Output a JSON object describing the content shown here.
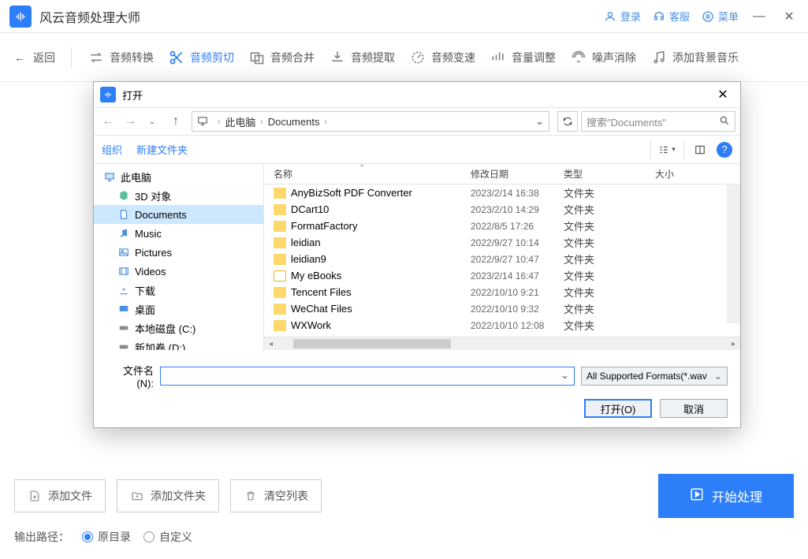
{
  "app": {
    "title": "风云音频处理大师"
  },
  "titlebar": {
    "login": "登录",
    "service": "客服",
    "menu": "菜单"
  },
  "toolbar": {
    "back": "返回",
    "items": [
      "音频转换",
      "音频剪切",
      "音频合并",
      "音频提取",
      "音频变速",
      "音量调整",
      "噪声消除",
      "添加背景音乐"
    ]
  },
  "bottom": {
    "add_file": "添加文件",
    "add_folder": "添加文件夹",
    "clear_list": "清空列表",
    "start": "开始处理",
    "out_label": "输出路径：",
    "orig": "原目录",
    "custom": "自定义"
  },
  "dialog": {
    "title": "打开",
    "crumbs": {
      "pc": "此电脑",
      "doc": "Documents"
    },
    "search_ph": "搜索\"Documents\"",
    "org": "组织",
    "newf": "新建文件夹",
    "cols": {
      "name": "名称",
      "date": "修改日期",
      "type": "类型",
      "size": "大小"
    },
    "tree": [
      {
        "label": "此电脑",
        "icon": "pc",
        "lvl": 0
      },
      {
        "label": "3D 对象",
        "icon": "3d",
        "lvl": 1
      },
      {
        "label": "Documents",
        "icon": "doc",
        "lvl": 1,
        "selected": true
      },
      {
        "label": "Music",
        "icon": "music",
        "lvl": 1
      },
      {
        "label": "Pictures",
        "icon": "pic",
        "lvl": 1
      },
      {
        "label": "Videos",
        "icon": "vid",
        "lvl": 1
      },
      {
        "label": "下载",
        "icon": "dl",
        "lvl": 1
      },
      {
        "label": "桌面",
        "icon": "desk",
        "lvl": 1
      },
      {
        "label": "本地磁盘 (C:)",
        "icon": "disk",
        "lvl": 1
      },
      {
        "label": "新加卷 (D:)",
        "icon": "disk",
        "lvl": 1
      }
    ],
    "files": [
      {
        "name": "AnyBizSoft PDF Converter",
        "date": "2023/2/14 16:38",
        "type": "文件夹",
        "icon": "folder"
      },
      {
        "name": "DCart10",
        "date": "2023/2/10 14:29",
        "type": "文件夹",
        "icon": "folder"
      },
      {
        "name": "FormatFactory",
        "date": "2022/8/5 17:26",
        "type": "文件夹",
        "icon": "folder"
      },
      {
        "name": "leidian",
        "date": "2022/9/27 10:14",
        "type": "文件夹",
        "icon": "folder"
      },
      {
        "name": "leidian9",
        "date": "2022/9/27 10:47",
        "type": "文件夹",
        "icon": "folder"
      },
      {
        "name": "My eBooks",
        "date": "2023/2/14 16:47",
        "type": "文件夹",
        "icon": "docf"
      },
      {
        "name": "Tencent Files",
        "date": "2022/10/10 9:21",
        "type": "文件夹",
        "icon": "folder"
      },
      {
        "name": "WeChat Files",
        "date": "2022/10/10 9:32",
        "type": "文件夹",
        "icon": "folder"
      },
      {
        "name": "WXWork",
        "date": "2022/10/10 12:08",
        "type": "文件夹",
        "icon": "folder"
      }
    ],
    "fn_label": "文件名(N):",
    "format": "All Supported Formats(*.wav",
    "open_btn": "打开(O)",
    "cancel_btn": "取消"
  }
}
